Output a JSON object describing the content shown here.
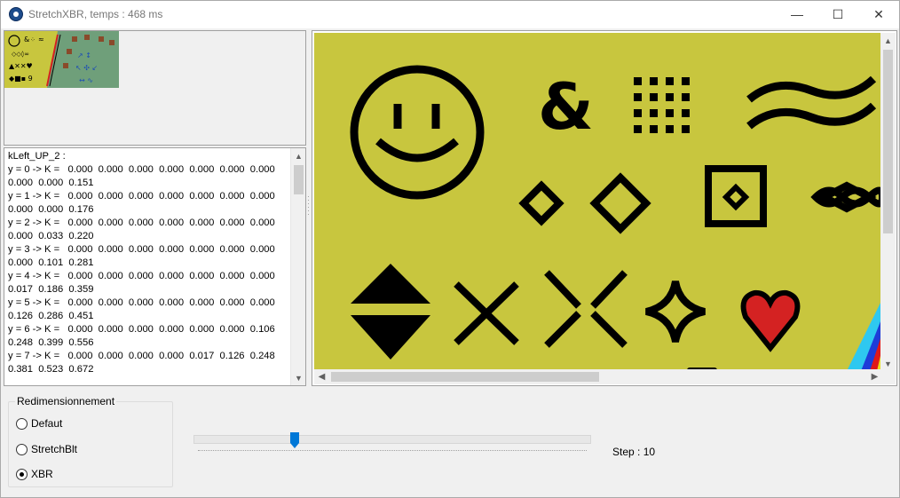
{
  "window": {
    "title": "StretchXBR, temps : 468 ms",
    "controls": {
      "minimize": "—",
      "maximize": "☐",
      "close": "✕"
    }
  },
  "text_panel": {
    "lines": [
      "kLeft_UP_2 :",
      "y = 0 -> K =   0.000  0.000  0.000  0.000  0.000  0.000  0.000",
      "0.000  0.000  0.151",
      "y = 1 -> K =   0.000  0.000  0.000  0.000  0.000  0.000  0.000",
      "0.000  0.000  0.176",
      "y = 2 -> K =   0.000  0.000  0.000  0.000  0.000  0.000  0.000",
      "0.000  0.033  0.220",
      "y = 3 -> K =   0.000  0.000  0.000  0.000  0.000  0.000  0.000",
      "0.000  0.101  0.281",
      "y = 4 -> K =   0.000  0.000  0.000  0.000  0.000  0.000  0.000",
      "0.017  0.186  0.359",
      "y = 5 -> K =   0.000  0.000  0.000  0.000  0.000  0.000  0.000",
      "0.126  0.286  0.451",
      "y = 6 -> K =   0.000  0.000  0.000  0.000  0.000  0.000  0.106",
      "0.248  0.399  0.556",
      "y = 7 -> K =   0.000  0.000  0.000  0.000  0.017  0.126  0.248",
      "0.381  0.523  0.672"
    ]
  },
  "resize_group": {
    "title": "Redimensionnement",
    "options": [
      {
        "label": "Defaut",
        "checked": false
      },
      {
        "label": "StretchBlt",
        "checked": false
      },
      {
        "label": "XBR",
        "checked": true
      }
    ]
  },
  "slider": {
    "step_label": "Step : 10",
    "position_fraction": 0.25
  },
  "colors": {
    "canvas_bg": "#c8c63e",
    "thumb_right_bg": "#6f9f7a",
    "heart": "#d42222",
    "slider_thumb": "#0078d7"
  },
  "icons": [
    "app-icon",
    "minimize-icon",
    "maximize-icon",
    "close-icon",
    "scroll-up-icon",
    "scroll-down-icon",
    "scroll-left-icon",
    "scroll-right-icon"
  ]
}
